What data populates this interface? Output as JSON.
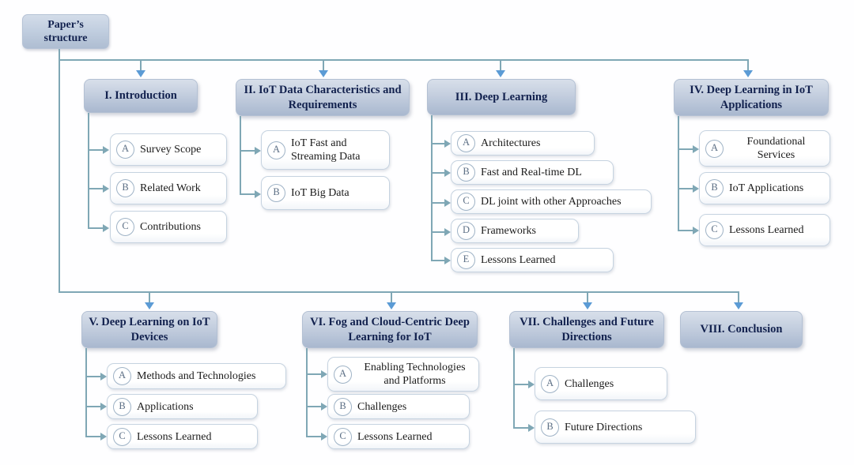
{
  "diagram": {
    "title": "Paper's structure",
    "root": {
      "label": "Paper’s structure"
    },
    "colors": {
      "header_fill_top": "#d8dfea",
      "header_fill_bottom": "#a9b8cf",
      "header_text": "#12214e",
      "child_fill": "#ffffff",
      "child_border": "#c6d3e0",
      "badge_text": "#5c6f85",
      "connector": "#7fa7b5",
      "arrow": "#5b9bd5",
      "background": "#fefeff"
    },
    "sections": [
      {
        "id": "I",
        "label": "I. Introduction",
        "children": [
          {
            "badge": "A",
            "label": "Survey Scope"
          },
          {
            "badge": "B",
            "label": "Related Work"
          },
          {
            "badge": "C",
            "label": "Contributions"
          }
        ]
      },
      {
        "id": "II",
        "label": "II. IoT Data Characteristics and Requirements",
        "children": [
          {
            "badge": "A",
            "label": "IoT Fast and Streaming Data"
          },
          {
            "badge": "B",
            "label": "IoT Big Data"
          }
        ]
      },
      {
        "id": "III",
        "label": "III. Deep Learning",
        "children": [
          {
            "badge": "A",
            "label": "Architectures"
          },
          {
            "badge": "B",
            "label": "Fast and Real-time DL"
          },
          {
            "badge": "C",
            "label": "DL joint with other Approaches"
          },
          {
            "badge": "D",
            "label": "Frameworks"
          },
          {
            "badge": "E",
            "label": "Lessons Learned"
          }
        ]
      },
      {
        "id": "IV",
        "label": "IV. Deep Learning in IoT Applications",
        "children": [
          {
            "badge": "A",
            "label": "Foundational Services"
          },
          {
            "badge": "B",
            "label": "IoT Applications"
          },
          {
            "badge": "C",
            "label": "Lessons Learned"
          }
        ]
      },
      {
        "id": "V",
        "label": "V. Deep Learning on IoT Devices",
        "children": [
          {
            "badge": "A",
            "label": "Methods and Technologies"
          },
          {
            "badge": "B",
            "label": "Applications"
          },
          {
            "badge": "C",
            "label": "Lessons Learned"
          }
        ]
      },
      {
        "id": "VI",
        "label": "VI. Fog and Cloud-Centric Deep Learning for IoT",
        "children": [
          {
            "badge": "A",
            "label": "Enabling Technologies and Platforms"
          },
          {
            "badge": "B",
            "label": "Challenges"
          },
          {
            "badge": "C",
            "label": "Lessons Learned"
          }
        ]
      },
      {
        "id": "VII",
        "label": "VII. Challenges and Future Directions",
        "children": [
          {
            "badge": "A",
            "label": "Challenges"
          },
          {
            "badge": "B",
            "label": "Future Directions"
          }
        ]
      },
      {
        "id": "VIII",
        "label": "VIII. Conclusion",
        "children": []
      }
    ]
  }
}
